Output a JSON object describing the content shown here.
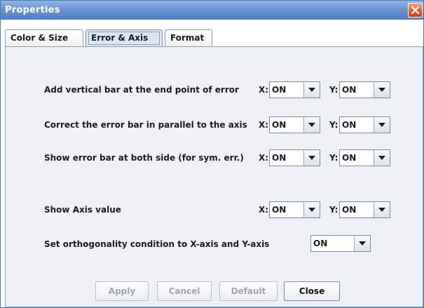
{
  "window": {
    "title": "Properties"
  },
  "tabs": [
    {
      "label": "Color & Size",
      "active": false
    },
    {
      "label": "Error & Axis",
      "active": true
    },
    {
      "label": "Format",
      "active": false
    }
  ],
  "rows": [
    {
      "label": "Add vertical bar at the end point of error",
      "x_label": "X:",
      "x_value": "ON",
      "y_label": "Y:",
      "y_value": "ON"
    },
    {
      "label": "Correct the error bar in parallel to the axis",
      "x_label": "X:",
      "x_value": "ON",
      "y_label": "Y:",
      "y_value": "ON"
    },
    {
      "label": "Show error bar at both side (for sym. err.)",
      "x_label": "X:",
      "x_value": "ON",
      "y_label": "Y:",
      "y_value": "ON"
    },
    {
      "label": "Show Axis value",
      "x_label": "X:",
      "x_value": "ON",
      "y_label": "Y:",
      "y_value": "ON"
    }
  ],
  "orthogonality": {
    "label": "Set orthogonality condition to X-axis and Y-axis",
    "value": "ON"
  },
  "buttons": [
    {
      "label": "Apply",
      "enabled": false
    },
    {
      "label": "Cancel",
      "enabled": false
    },
    {
      "label": "Default",
      "enabled": false
    },
    {
      "label": "Close",
      "enabled": true
    }
  ],
  "icons": {
    "close": "close-icon",
    "dropdown": "chevron-down-icon"
  },
  "colors": {
    "titlebar": "#6a95d2",
    "close_button": "#e35a2a",
    "panel": "#eef1f6"
  }
}
